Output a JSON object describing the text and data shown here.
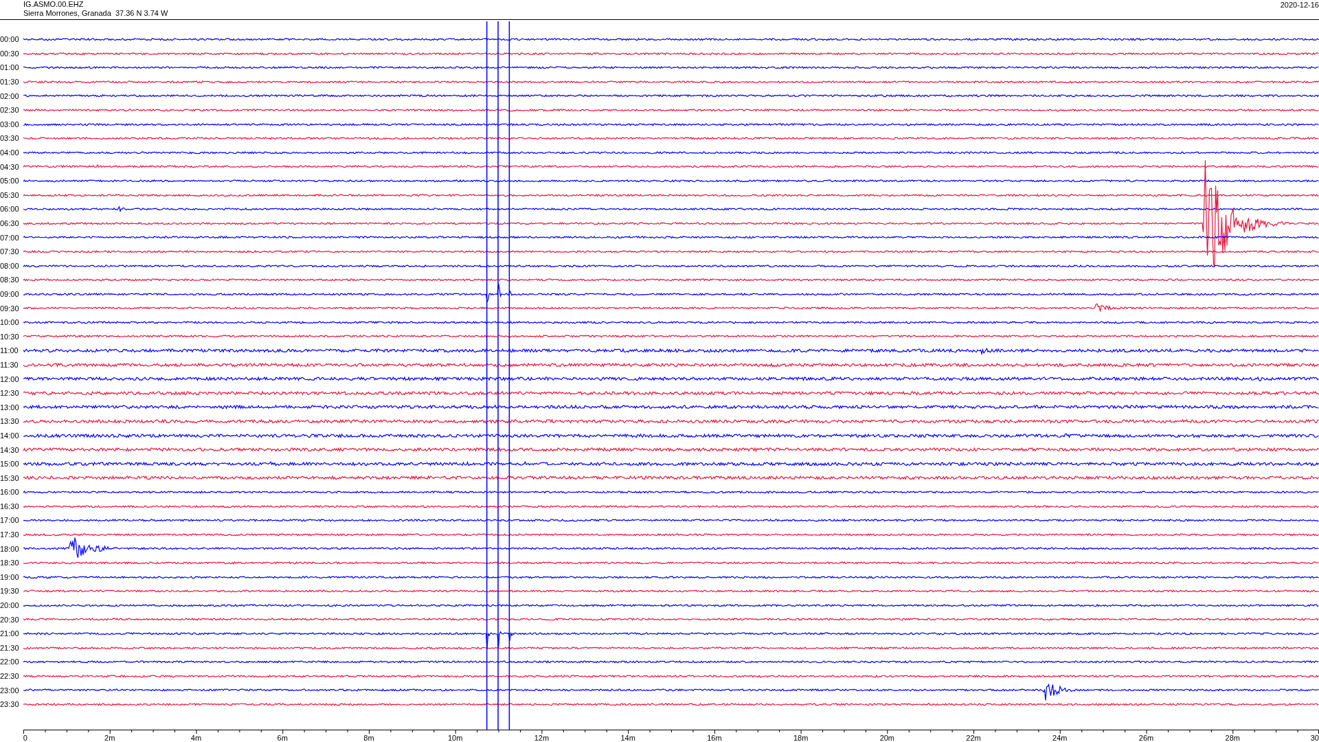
{
  "header": {
    "station": "IG.ASMO.00.EHZ",
    "location": "Sierra Morrones, Granada  37.36 N 3.74 W",
    "date": "2020-12-16"
  },
  "rows": [
    {
      "time": "00:00",
      "color": "#0000ff"
    },
    {
      "time": "00:30",
      "color": "#e8173c"
    },
    {
      "time": "01:00",
      "color": "#0000ff"
    },
    {
      "time": "01:30",
      "color": "#e8173c"
    },
    {
      "time": "02:00",
      "color": "#0000ff"
    },
    {
      "time": "02:30",
      "color": "#e8173c"
    },
    {
      "time": "03:00",
      "color": "#0000ff"
    },
    {
      "time": "03:30",
      "color": "#e8173c"
    },
    {
      "time": "04:00",
      "color": "#0000ff"
    },
    {
      "time": "04:30",
      "color": "#e8173c"
    },
    {
      "time": "05:00",
      "color": "#0000ff"
    },
    {
      "time": "05:30",
      "color": "#e8173c"
    },
    {
      "time": "06:00",
      "color": "#0000ff"
    },
    {
      "time": "06:30",
      "color": "#e8173c"
    },
    {
      "time": "07:00",
      "color": "#0000ff"
    },
    {
      "time": "07:30",
      "color": "#e8173c"
    },
    {
      "time": "08:00",
      "color": "#0000ff"
    },
    {
      "time": "08:30",
      "color": "#e8173c"
    },
    {
      "time": "09:00",
      "color": "#0000ff"
    },
    {
      "time": "09:30",
      "color": "#e8173c"
    },
    {
      "time": "10:00",
      "color": "#0000ff"
    },
    {
      "time": "10:30",
      "color": "#e8173c"
    },
    {
      "time": "11:00",
      "color": "#0000ff"
    },
    {
      "time": "11:30",
      "color": "#e8173c"
    },
    {
      "time": "12:00",
      "color": "#0000ff"
    },
    {
      "time": "12:30",
      "color": "#e8173c"
    },
    {
      "time": "13:00",
      "color": "#0000ff"
    },
    {
      "time": "13:30",
      "color": "#e8173c"
    },
    {
      "time": "14:00",
      "color": "#0000ff"
    },
    {
      "time": "14:30",
      "color": "#e8173c"
    },
    {
      "time": "15:00",
      "color": "#0000ff"
    },
    {
      "time": "15:30",
      "color": "#e8173c"
    },
    {
      "time": "16:00",
      "color": "#0000ff"
    },
    {
      "time": "16:30",
      "color": "#e8173c"
    },
    {
      "time": "17:00",
      "color": "#0000ff"
    },
    {
      "time": "17:30",
      "color": "#e8173c"
    },
    {
      "time": "18:00",
      "color": "#0000ff"
    },
    {
      "time": "18:30",
      "color": "#e8173c"
    },
    {
      "time": "19:00",
      "color": "#0000ff"
    },
    {
      "time": "19:30",
      "color": "#e8173c"
    },
    {
      "time": "20:00",
      "color": "#0000ff"
    },
    {
      "time": "20:30",
      "color": "#e8173c"
    },
    {
      "time": "21:00",
      "color": "#0000ff"
    },
    {
      "time": "21:30",
      "color": "#e8173c"
    },
    {
      "time": "22:00",
      "color": "#0000ff"
    },
    {
      "time": "22:30",
      "color": "#e8173c"
    },
    {
      "time": "23:00",
      "color": "#0000ff"
    },
    {
      "time": "23:30",
      "color": "#e8173c"
    }
  ],
  "x_axis": {
    "labels": [
      "0",
      "2m",
      "4m",
      "6m",
      "8m",
      "10m",
      "12m",
      "14m",
      "16m",
      "18m",
      "20m",
      "22m",
      "24m",
      "26m",
      "28m",
      "30"
    ]
  }
}
